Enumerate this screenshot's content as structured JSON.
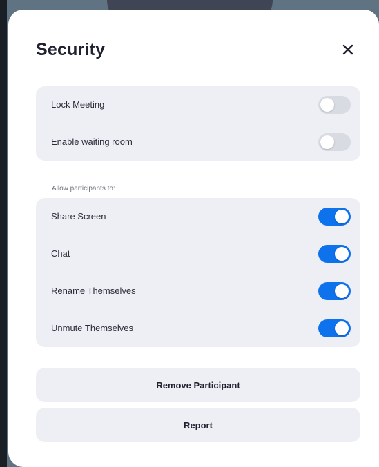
{
  "dialog": {
    "title": "Security",
    "close_icon": "close-icon"
  },
  "meeting_settings": [
    {
      "label": "Lock Meeting",
      "enabled": false
    },
    {
      "label": "Enable waiting room",
      "enabled": false
    }
  ],
  "participants_section": {
    "heading": "Allow participants to:",
    "items": [
      {
        "label": "Share Screen",
        "enabled": true
      },
      {
        "label": "Chat",
        "enabled": true
      },
      {
        "label": "Rename Themselves",
        "enabled": true
      },
      {
        "label": "Unmute Themselves",
        "enabled": true
      }
    ]
  },
  "actions": {
    "remove_label": "Remove Participant",
    "report_label": "Report"
  },
  "colors": {
    "toggle_on": "#0e72ed",
    "toggle_off": "#d9dbe3",
    "group_bg": "#eeeff4"
  }
}
